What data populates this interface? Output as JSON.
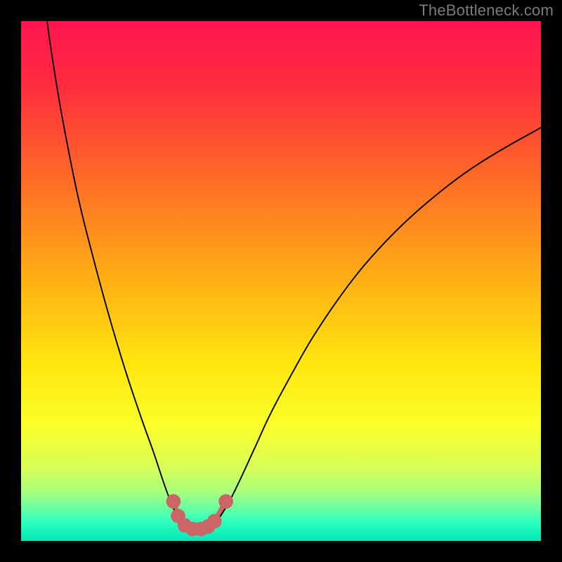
{
  "watermark": "TheBottleneck.com",
  "chart_data": {
    "type": "line",
    "title": "",
    "xlabel": "",
    "ylabel": "",
    "xlim": [
      0,
      100
    ],
    "ylim": [
      0,
      100
    ],
    "gradient_stops": [
      {
        "offset": 0.0,
        "color": "#ff1450"
      },
      {
        "offset": 0.12,
        "color": "#ff2b3f"
      },
      {
        "offset": 0.3,
        "color": "#ff6a27"
      },
      {
        "offset": 0.5,
        "color": "#ffb014"
      },
      {
        "offset": 0.66,
        "color": "#ffe60e"
      },
      {
        "offset": 0.78,
        "color": "#fbff2a"
      },
      {
        "offset": 0.86,
        "color": "#d7ff5a"
      },
      {
        "offset": 0.905,
        "color": "#aaff7d"
      },
      {
        "offset": 0.935,
        "color": "#6dffa0"
      },
      {
        "offset": 0.963,
        "color": "#2fffc0"
      },
      {
        "offset": 1.0,
        "color": "#00e7b5"
      }
    ],
    "series": [
      {
        "name": "curve",
        "stroke": "#000000",
        "stroke_width": 1.9,
        "points": [
          {
            "x": 5.0,
            "y": 100.0
          },
          {
            "x": 6.0,
            "y": 93.0
          },
          {
            "x": 8.0,
            "y": 81.0
          },
          {
            "x": 11.0,
            "y": 66.0
          },
          {
            "x": 14.0,
            "y": 54.0
          },
          {
            "x": 17.0,
            "y": 43.0
          },
          {
            "x": 20.0,
            "y": 33.0
          },
          {
            "x": 23.0,
            "y": 24.0
          },
          {
            "x": 25.5,
            "y": 17.0
          },
          {
            "x": 27.5,
            "y": 11.0
          },
          {
            "x": 29.0,
            "y": 7.0
          },
          {
            "x": 30.5,
            "y": 4.0
          },
          {
            "x": 32.0,
            "y": 2.6
          },
          {
            "x": 33.5,
            "y": 2.2
          },
          {
            "x": 35.0,
            "y": 2.2
          },
          {
            "x": 36.5,
            "y": 2.9
          },
          {
            "x": 38.0,
            "y": 4.3
          },
          {
            "x": 40.0,
            "y": 7.5
          },
          {
            "x": 42.0,
            "y": 11.5
          },
          {
            "x": 45.0,
            "y": 18.0
          },
          {
            "x": 48.0,
            "y": 24.5
          },
          {
            "x": 52.0,
            "y": 32.0
          },
          {
            "x": 56.0,
            "y": 39.0
          },
          {
            "x": 61.0,
            "y": 46.5
          },
          {
            "x": 66.0,
            "y": 53.0
          },
          {
            "x": 72.0,
            "y": 59.5
          },
          {
            "x": 78.0,
            "y": 65.0
          },
          {
            "x": 85.0,
            "y": 70.5
          },
          {
            "x": 92.0,
            "y": 75.0
          },
          {
            "x": 100.0,
            "y": 79.5
          }
        ]
      }
    ],
    "markers": [
      {
        "x": 29.3,
        "y": 7.6,
        "r": 1.4,
        "fill": "#cc6666"
      },
      {
        "x": 30.2,
        "y": 4.8,
        "r": 1.4,
        "fill": "#cc6666"
      },
      {
        "x": 31.5,
        "y": 3.0,
        "r": 1.4,
        "fill": "#cc6666"
      },
      {
        "x": 33.0,
        "y": 2.3,
        "r": 1.4,
        "fill": "#cc6666"
      },
      {
        "x": 34.6,
        "y": 2.3,
        "r": 1.4,
        "fill": "#cc6666"
      },
      {
        "x": 36.0,
        "y": 2.8,
        "r": 1.4,
        "fill": "#cc6666"
      },
      {
        "x": 37.2,
        "y": 3.8,
        "r": 1.4,
        "fill": "#cc6666"
      },
      {
        "x": 39.4,
        "y": 7.6,
        "r": 1.4,
        "fill": "#cc6666"
      }
    ],
    "marker_connector": {
      "stroke": "#cc6666",
      "stroke_width": 7.5,
      "points_index_range": [
        0,
        7
      ]
    }
  }
}
